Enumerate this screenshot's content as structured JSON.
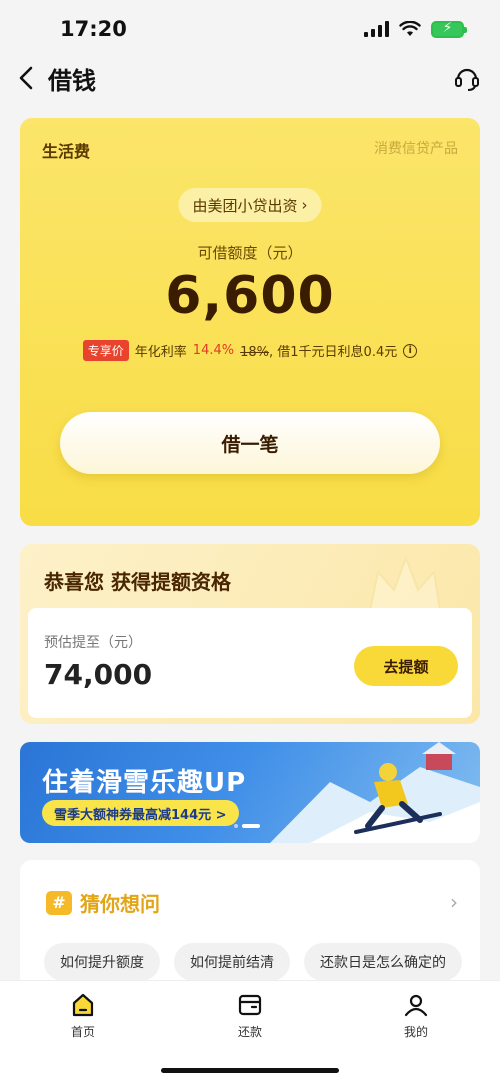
{
  "status_bar": {
    "time": "17:20"
  },
  "nav": {
    "title": "借钱"
  },
  "loan_card": {
    "category": "生活费",
    "product_type": "消费信贷产品",
    "lender": "由美团小贷出资",
    "limit_label": "可借额度（元）",
    "limit_amount": "6,600",
    "badge": "专享价",
    "rate_prefix": "年化利率",
    "rate_current": "14.4%",
    "rate_old": "18%",
    "rate_suffix": ", 借1千元日利息0.4元",
    "borrow_button": "借一笔"
  },
  "upgrade_card": {
    "title": "恭喜您 获得提额资格",
    "estimate_label": "预估提至（元）",
    "estimate_amount": "74,000",
    "button": "去提额"
  },
  "banner": {
    "title": "住着滑雪乐趣UP",
    "subtitle": "雪季大额神券最高减144元 >"
  },
  "faq": {
    "title": "猜你想问",
    "chips": [
      "如何提升额度",
      "如何提前结清",
      "还款日是怎么确定的"
    ]
  },
  "tab_bar": {
    "items": [
      {
        "label": "首页",
        "icon": "home-icon"
      },
      {
        "label": "还款",
        "icon": "repay-icon"
      },
      {
        "label": "我的",
        "icon": "profile-icon"
      }
    ]
  },
  "colors": {
    "card_yellow": "#f8dd45",
    "accent_red": "#e23b26",
    "button_yellow": "#f8d938",
    "faq_orange": "#e3a416",
    "banner_blue": "#2a75d6"
  }
}
